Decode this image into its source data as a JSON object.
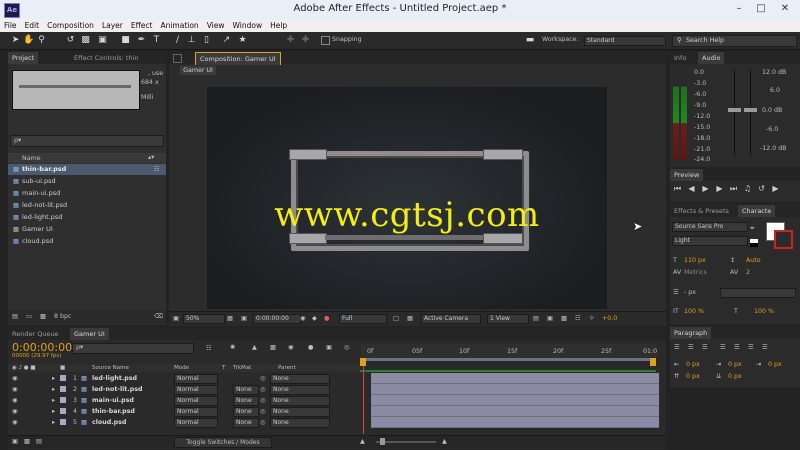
{
  "app": {
    "title": "Adobe After Effects - Untitled Project.aep *",
    "icon_text": "Ae"
  },
  "menu": [
    "File",
    "Edit",
    "Composition",
    "Layer",
    "Effect",
    "Animation",
    "View",
    "Window",
    "Help"
  ],
  "toolbar": {
    "snapping_label": "Snapping",
    "workspace_label": "Workspace:",
    "workspace_value": "Standard",
    "search_placeholder": "Search Help"
  },
  "project": {
    "tab": "Project",
    "effect_controls_tab": "Effect Controls: thin",
    "preview_info": ", use",
    "preview_dims": "684 x",
    "preview_dur": "Milli",
    "search_placeholder": "ρ▾",
    "column_name": "Name",
    "items": [
      "thin-bar.psd",
      "sub-ui.psd",
      "main-ui.psd",
      "led-not-lit.psd",
      "led-light.psd",
      "Gamer UI",
      "cloud.psd"
    ],
    "bpc": "8 bpc"
  },
  "composition": {
    "tab": "Composition: Gamer UI",
    "subtab": "Gamer UI",
    "zoom": "50%",
    "timecode": "0:00:00:00",
    "resolution": "Full",
    "camera": "Active Camera",
    "view": "1 View",
    "offset": "+0.0",
    "watermark": "www.cgtsj.com"
  },
  "info_audio": {
    "tab_info": "Info",
    "tab_audio": "Audio",
    "left_scale": [
      "0.0",
      "-3.0",
      "-6.0",
      "-9.0",
      "-12.0",
      "-15.0",
      "-18.0",
      "-21.0",
      "-24.0"
    ],
    "right_scale": [
      "12.0 dB",
      "6.0",
      "0.0 dB",
      "-6.0",
      "-12.0 dB"
    ]
  },
  "preview": {
    "tab": "Preview"
  },
  "character": {
    "tab_effects": "Effects & Presets",
    "tab_character": "Characte",
    "font": "Source Sans Pro",
    "style": "Light",
    "size": "110 px",
    "leading": "Auto",
    "kerning": "Metrics",
    "tracking": "2",
    "stroke_unit": "- px",
    "vscale": "100 %",
    "hscale": "100 %"
  },
  "paragraph": {
    "tab": "Paragraph",
    "values": [
      "0 px",
      "0 px",
      "0 px",
      "0 px",
      "0 px"
    ]
  },
  "timeline": {
    "render_tab": "Render Queue",
    "comp_tab": "Gamer UI",
    "timecode": "0:00:00:00",
    "frame_info": "00000 (29.97 fps)",
    "search_placeholder": "ρ▾",
    "col_source": "Source Name",
    "col_mode": "Mode",
    "col_t": "T",
    "col_trkmat": "TrkMat",
    "col_parent": "Parent",
    "ruler": [
      "0f",
      "05f",
      "10f",
      "15f",
      "20f",
      "25f",
      "01:0"
    ],
    "layers": [
      {
        "num": "1",
        "name": "led-light.psd",
        "mode": "Normal",
        "trkmat": "",
        "parent": "None",
        "color": "#b2a3c9"
      },
      {
        "num": "2",
        "name": "led-not-lit.psd",
        "mode": "Normal",
        "trkmat": "None",
        "parent": "None",
        "color": "#b2a3c9"
      },
      {
        "num": "3",
        "name": "main-ui.psd",
        "mode": "Normal",
        "trkmat": "None",
        "parent": "None",
        "color": "#b2a3c9"
      },
      {
        "num": "4",
        "name": "thin-bar.psd",
        "mode": "Normal",
        "trkmat": "None",
        "parent": "None",
        "color": "#b2a3c9"
      },
      {
        "num": "5",
        "name": "cloud.psd",
        "mode": "Normal",
        "trkmat": "None",
        "parent": "None",
        "color": "#b2a3c9"
      }
    ],
    "toggle_label": "Toggle Switches / Modes"
  }
}
